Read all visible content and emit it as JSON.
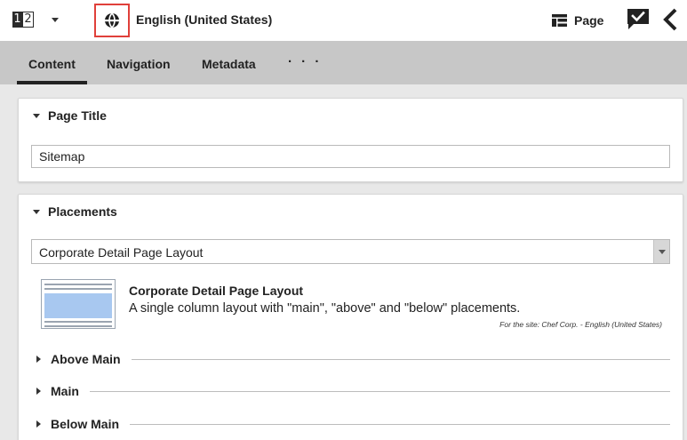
{
  "toolbar": {
    "num_left": "1",
    "num_right": "2",
    "language": "English (United States)",
    "page_label": "Page",
    "accent_color": "#e0403a"
  },
  "icons": {
    "numbering": "numbered-list-icon",
    "dropdown": "chevron-down-icon",
    "locale": "globe-icon",
    "page": "page-layout-icon",
    "comment": "chat-check-icon",
    "collapse": "chevron-left-icon"
  },
  "tabs": [
    {
      "label": "Content",
      "active": true
    },
    {
      "label": "Navigation",
      "active": false
    },
    {
      "label": "Metadata",
      "active": false
    }
  ],
  "tabs_more": "· · ·",
  "page_title_panel": {
    "header": "Page Title",
    "value": "Sitemap"
  },
  "placements_panel": {
    "header": "Placements",
    "selected_layout": "Corporate Detail Page Layout",
    "layout_title": "Corporate Detail Page Layout",
    "layout_description": "A single column layout with \"main\", \"above\" and \"below\" placements.",
    "layout_site": "For the site: Chef Corp. - English (United States)",
    "placements": [
      "Above Main",
      "Main",
      "Below Main"
    ]
  }
}
